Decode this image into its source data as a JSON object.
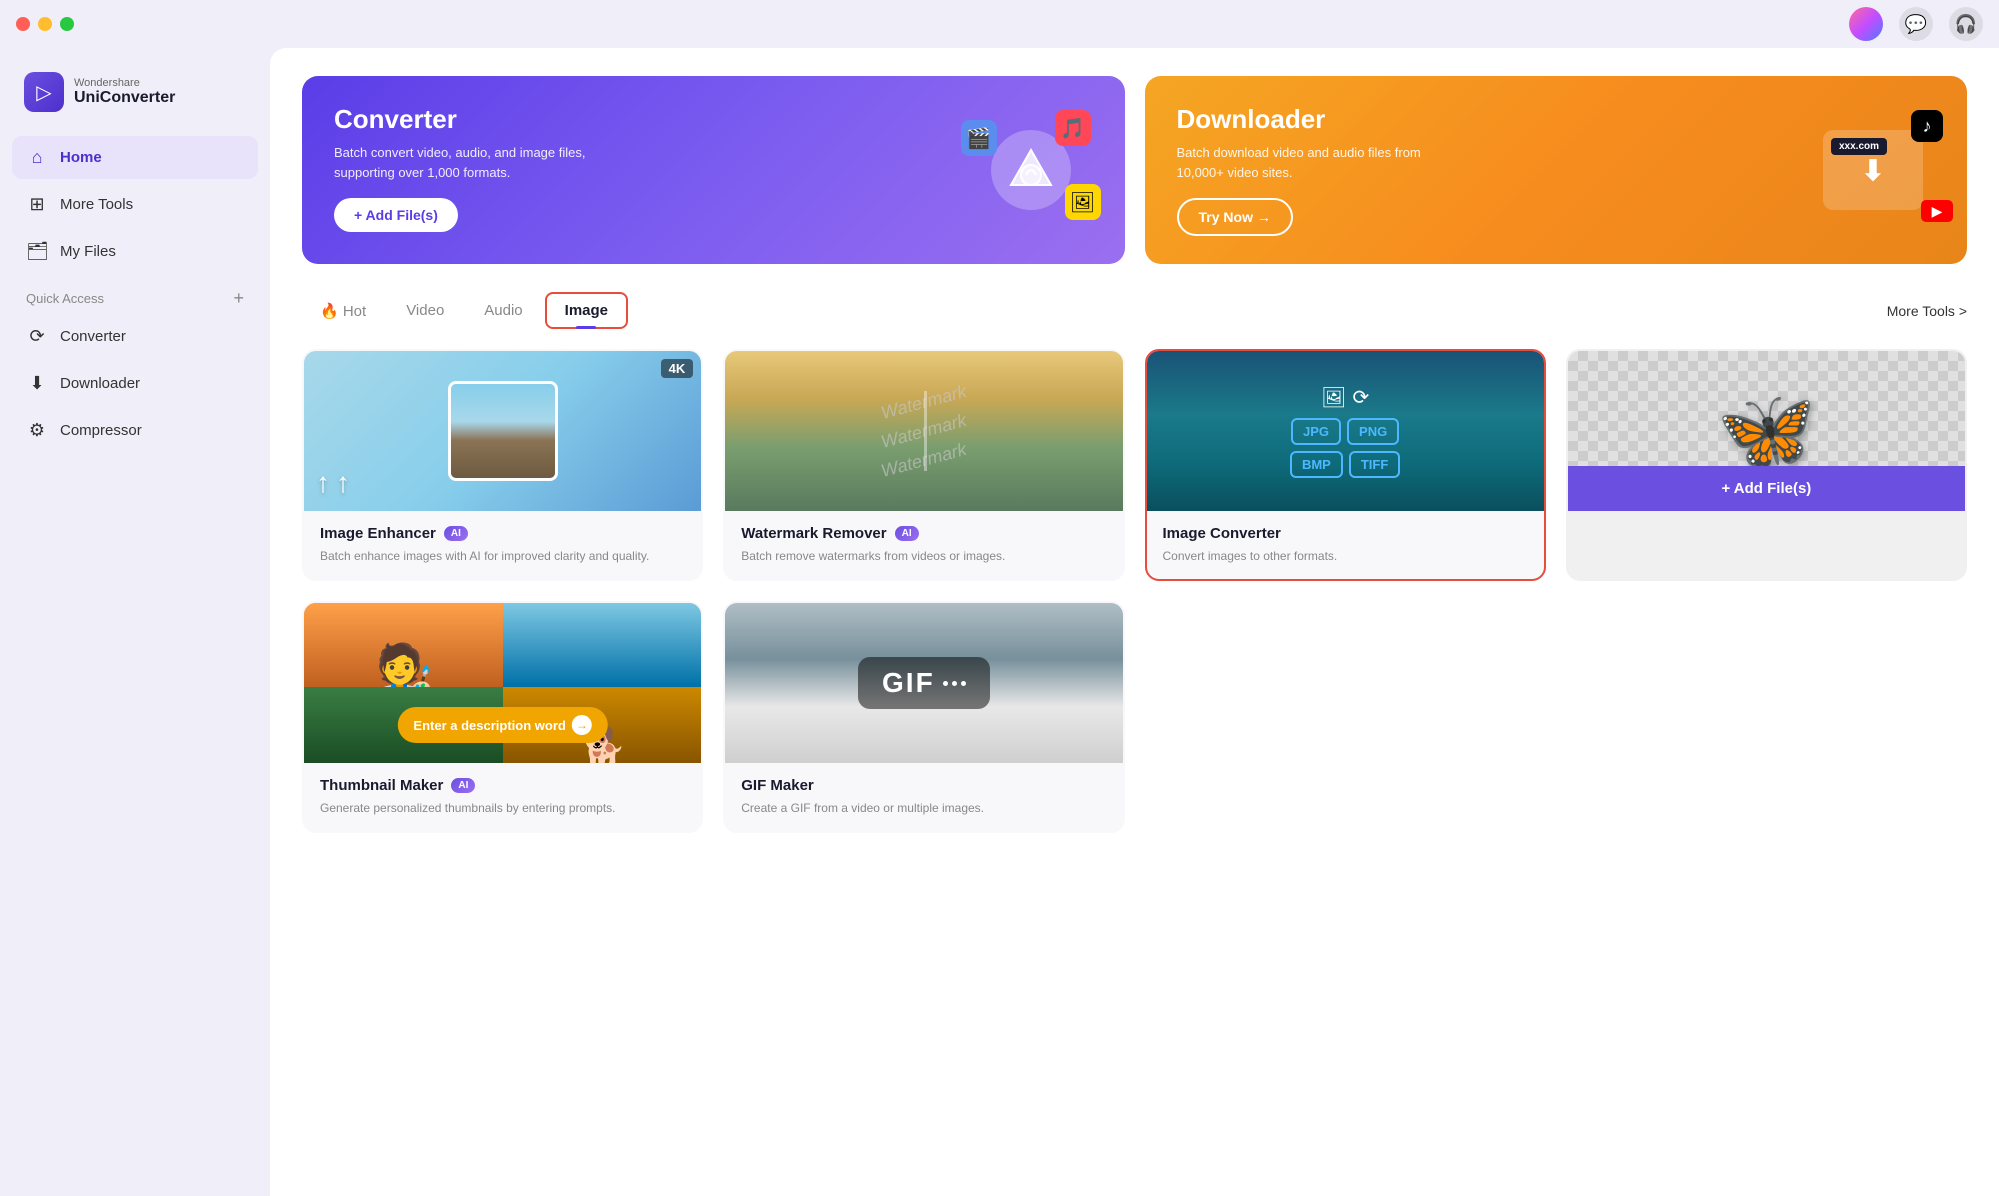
{
  "window": {
    "title": "Wondershare UniConverter"
  },
  "titlebar": {
    "dots": [
      "red",
      "yellow",
      "green"
    ]
  },
  "logo": {
    "brand": "Wondershare",
    "name": "UniConverter"
  },
  "sidebar": {
    "home_label": "Home",
    "more_tools_label": "More Tools",
    "my_files_label": "My Files",
    "quick_access_label": "Quick Access",
    "converter_label": "Converter",
    "downloader_label": "Downloader",
    "compressor_label": "Compressor"
  },
  "banners": {
    "converter": {
      "title": "Converter",
      "desc": "Batch convert video, audio, and image files, supporting over 1,000 formats.",
      "btn": "+ Add File(s)"
    },
    "downloader": {
      "title": "Downloader",
      "desc": "Batch download video and audio files from 10,000+ video sites.",
      "btn": "Try Now →"
    }
  },
  "tabs": {
    "hot": "🔥 Hot",
    "video": "Video",
    "audio": "Audio",
    "image": "Image",
    "more_tools": "More Tools >"
  },
  "tools": [
    {
      "id": "image-enhancer",
      "title": "Image Enhancer",
      "ai": true,
      "desc": "Batch enhance images with AI for improved clarity and quality.",
      "badge": "4K"
    },
    {
      "id": "watermark-remover",
      "title": "Watermark Remover",
      "ai": true,
      "desc": "Batch remove watermarks from videos or images."
    },
    {
      "id": "image-converter",
      "title": "Image Converter",
      "ai": false,
      "desc": "Convert images to other formats.",
      "formats": [
        "JPG",
        "PNG",
        "BMP",
        "TIFF"
      ],
      "selected": true
    },
    {
      "id": "add-files",
      "title": "",
      "btn": "+ Add File(s)",
      "is_add": true
    },
    {
      "id": "thumbnail-maker",
      "title": "Thumbnail Maker",
      "ai": true,
      "desc": "Generate personalized thumbnails by entering prompts.",
      "prompt": "Enter a description word"
    },
    {
      "id": "gif-maker",
      "title": "GIF Maker",
      "ai": false,
      "desc": "Create a GIF from a video or multiple images.",
      "gif_label": "GIF"
    }
  ],
  "icons": {
    "home": "⌂",
    "more_tools": "⊞",
    "my_files": "🗂",
    "converter": "⟳",
    "downloader": "⬇",
    "compressor": "⚙",
    "plus": "+",
    "chat": "💬",
    "headphone": "🎧"
  }
}
